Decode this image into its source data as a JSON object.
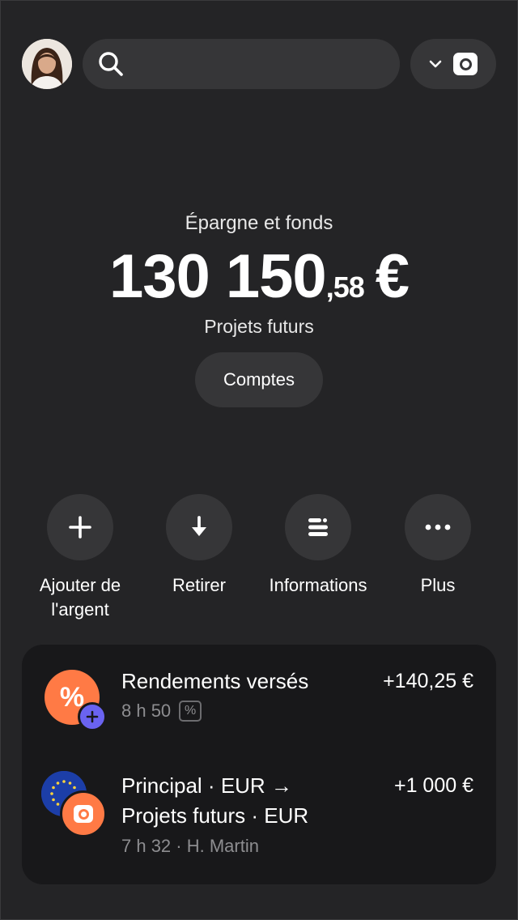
{
  "header": {
    "avatar_icon": "user-avatar",
    "search_icon": "search-icon",
    "switcher_icons": [
      "chevron-down-icon",
      "vault-icon"
    ]
  },
  "hero": {
    "label": "Épargne et fonds",
    "balance_integer": "130 150",
    "balance_decimal": ",58",
    "balance_currency": "€",
    "account_name": "Projets futurs",
    "accounts_button": "Comptes"
  },
  "actions": [
    {
      "label": "Ajouter de l'argent",
      "icon": "plus-icon"
    },
    {
      "label": "Retirer",
      "icon": "arrow-down-icon"
    },
    {
      "label": "Informations",
      "icon": "list-icon"
    },
    {
      "label": "Plus",
      "icon": "more-icon"
    }
  ],
  "transactions": [
    {
      "title": "Rendements versés",
      "amount": "+140,25 €",
      "meta": "8 h 50",
      "badge": "%",
      "icon": "percent-icon",
      "icon_badge": "plus-icon"
    },
    {
      "title_line1": "Principal · EUR →",
      "title_line2": "Projets futurs · EUR",
      "amount": "+1 000 €",
      "meta": "7 h 32 · H. Martin",
      "icon": "eu-flag-icon",
      "icon_badge": "vault-icon"
    }
  ],
  "colors": {
    "background": "#242426",
    "surface": "#363638",
    "card": "#18181a",
    "accent_orange": "#ff7a45",
    "accent_purple": "#6a63f0"
  }
}
